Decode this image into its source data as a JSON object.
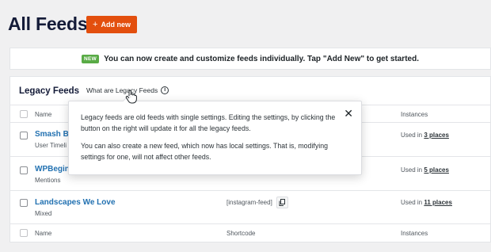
{
  "header": {
    "title": "All Feeds",
    "add_new_icon": "+",
    "add_new_label": "Add new"
  },
  "notice": {
    "badge": "NEW",
    "text": "You can now create and customize feeds individually.  Tap \"Add New\" to get started."
  },
  "legacy": {
    "title": "Legacy Feeds",
    "help_link": "What are Legacy Feeds",
    "help_icon": "info-icon"
  },
  "table": {
    "columns": {
      "name": "Name",
      "shortcode": "Shortcode",
      "instances": "Instances"
    },
    "rows": [
      {
        "name": "Smash Ba",
        "type": "User Timeli",
        "instances_prefix": "Used in",
        "instances_link": "3 places"
      },
      {
        "name": "WPBegin",
        "type": "Mentions",
        "instances_prefix": "Used in",
        "instances_link": "5 places"
      },
      {
        "name": "Landscapes We Love",
        "type": "Mixed",
        "shortcode": "[instagram-feed]",
        "instances_prefix": "Used in",
        "instances_link": "11 places"
      }
    ]
  },
  "tooltip": {
    "paragraph1": "Legacy feeds are old feeds with single settings. Editing the settings, by clicking the button on the right will update it for all the legacy feeds.",
    "paragraph2": "You can also create a new feed, which now has local settings. That is, modifying settings for one, will not affect other feeds.",
    "close_icon": "close-icon"
  },
  "colors": {
    "accent": "#e34f0e",
    "link": "#2271b1",
    "badge": "#59ab46",
    "title": "#141b38"
  }
}
